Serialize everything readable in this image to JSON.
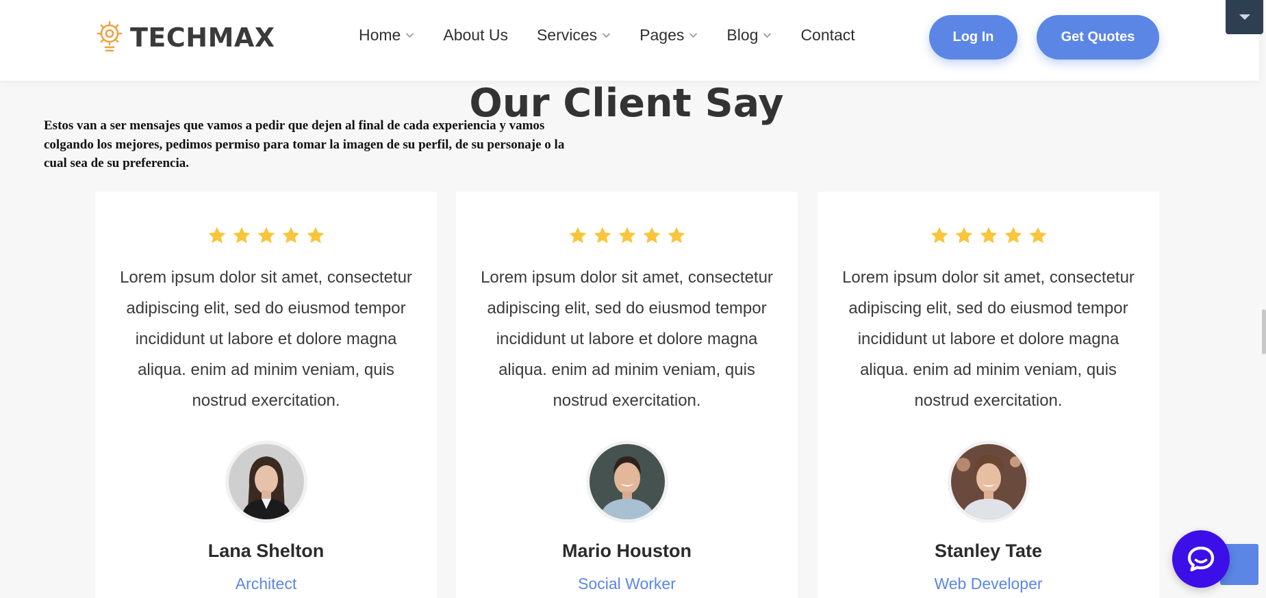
{
  "brand": {
    "name": "TECHMAX",
    "icon": "lightbulb-gear-icon",
    "accent": "#f0a040"
  },
  "nav": {
    "items": [
      {
        "label": "Home",
        "has_dropdown": true
      },
      {
        "label": "About Us",
        "has_dropdown": false
      },
      {
        "label": "Services",
        "has_dropdown": true
      },
      {
        "label": "Pages",
        "has_dropdown": true
      },
      {
        "label": "Blog",
        "has_dropdown": true
      },
      {
        "label": "Contact",
        "has_dropdown": false
      }
    ]
  },
  "actions": {
    "login_label": "Log In",
    "quotes_label": "Get Quotes"
  },
  "section": {
    "title": "Our Client Say",
    "intro": "Estos van a ser mensajes que vamos a pedir que dejen al final de cada experiencia y vamos colgando los mejores, pedimos permiso para tomar la imagen de su perfil, de su personaje o la cual sea de su preferencia."
  },
  "testimonials": [
    {
      "rating": 5,
      "quote": "Lorem ipsum dolor sit amet, consectetur adipiscing elit, sed do eiusmod tempor incididunt ut labore et dolore magna aliqua. enim ad minim veniam, quis nostrud exercitation.",
      "name": "Lana Shelton",
      "role": "Architect"
    },
    {
      "rating": 5,
      "quote": "Lorem ipsum dolor sit amet, consectetur adipiscing elit, sed do eiusmod tempor incididunt ut labore et dolore magna aliqua. enim ad minim veniam, quis nostrud exercitation.",
      "name": "Mario Houston",
      "role": "Social Worker"
    },
    {
      "rating": 5,
      "quote": "Lorem ipsum dolor sit amet, consectetur adipiscing elit, sed do eiusmod tempor incididunt ut labore et dolore magna aliqua. enim ad minim veniam, quis nostrud exercitation.",
      "name": "Stanley Tate",
      "role": "Web Developer"
    }
  ],
  "colors": {
    "primary": "#5b86e5",
    "star": "#f9c53a",
    "chat": "#3c0fe8",
    "heading": "#333333",
    "corner_tab": "#2f3f52"
  },
  "icons": {
    "star": "star-icon",
    "chat": "chat-bubble-icon",
    "dropdown": "chevron-down-icon",
    "corner": "caret-down-icon"
  }
}
